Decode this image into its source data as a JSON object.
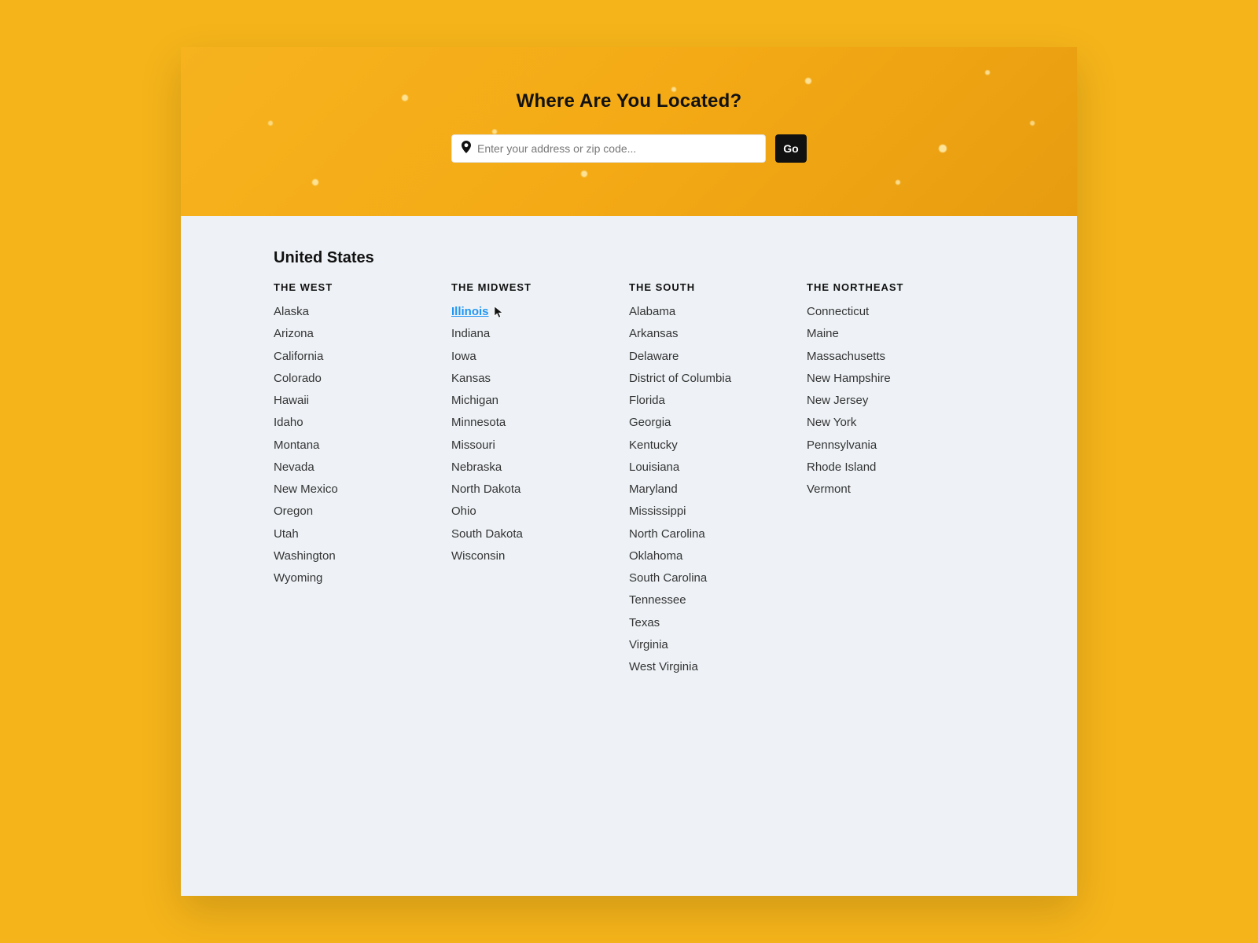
{
  "hero": {
    "title": "Where Are You Located?",
    "search_placeholder": "Enter your address or zip code...",
    "go_label": "Go"
  },
  "country_title": "United States",
  "hover_state": "Illinois",
  "regions": [
    {
      "title": "THE WEST",
      "states": [
        "Alaska",
        "Arizona",
        "California",
        "Colorado",
        "Hawaii",
        "Idaho",
        "Montana",
        "Nevada",
        "New Mexico",
        "Oregon",
        "Utah",
        "Washington",
        "Wyoming"
      ]
    },
    {
      "title": "THE MIDWEST",
      "states": [
        "Illinois",
        "Indiana",
        "Iowa",
        "Kansas",
        "Michigan",
        "Minnesota",
        "Missouri",
        "Nebraska",
        "North Dakota",
        "Ohio",
        "South Dakota",
        "Wisconsin"
      ]
    },
    {
      "title": "THE SOUTH",
      "states": [
        "Alabama",
        "Arkansas",
        "Delaware",
        "District of Columbia",
        "Florida",
        "Georgia",
        "Kentucky",
        "Louisiana",
        "Maryland",
        "Mississippi",
        "North Carolina",
        "Oklahoma",
        "South Carolina",
        "Tennessee",
        "Texas",
        "Virginia",
        "West Virginia"
      ]
    },
    {
      "title": "THE NORTHEAST",
      "states": [
        "Connecticut",
        "Maine",
        "Massachusetts",
        "New Hampshire",
        "New Jersey",
        "New York",
        "Pennsylvania",
        "Rhode Island",
        "Vermont"
      ]
    }
  ]
}
